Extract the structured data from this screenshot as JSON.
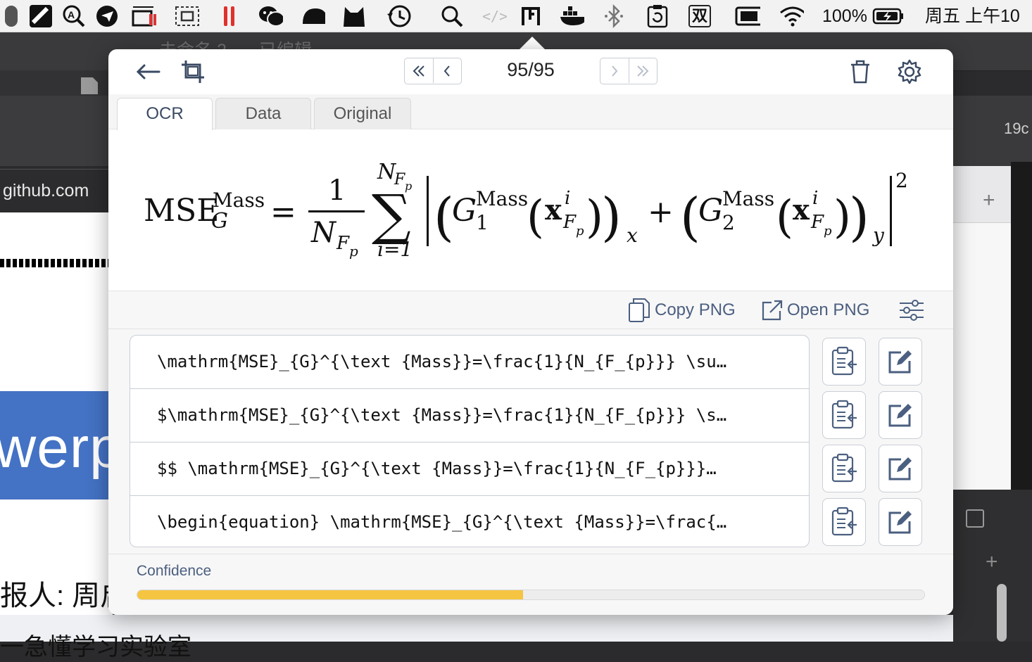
{
  "menubar": {
    "battery": "100%",
    "ime": "双",
    "datetime": "周五 上午10"
  },
  "background": {
    "browser_url": "github.com",
    "ghost_title_1": "未命名 2",
    "ghost_title_2": "已编辑",
    "slide_text": "werp",
    "reporter_text": "报人: 周启",
    "lab_text": "一急懂学习实验室",
    "right_text": "19c"
  },
  "popup": {
    "page_counter": "95/95",
    "tabs": [
      {
        "label": "OCR",
        "active": true
      },
      {
        "label": "Data",
        "active": false
      },
      {
        "label": "Original",
        "active": false
      }
    ],
    "actions": {
      "copy_png": "Copy PNG",
      "open_png": "Open PNG"
    },
    "results": [
      "\\mathrm{MSE}_{G}^{\\text {Mass}}=\\frac{1}{N_{F_{p}}} \\su…",
      "$\\mathrm{MSE}_{G}^{\\text {Mass}}=\\frac{1}{N_{F_{p}}} \\s…",
      "$$ \\mathrm{MSE}_{G}^{\\text {Mass}}=\\frac{1}{N_{F_{p}}}…",
      "\\begin{equation} \\mathrm{MSE}_{G}^{\\text {Mass}}=\\frac{…"
    ],
    "confidence": {
      "label": "Confidence",
      "value": 0.49,
      "bar_color": "#f5c542"
    },
    "formula": {
      "mse": "MSE",
      "mass": "Mass",
      "g": "G",
      "one": "1",
      "nf": "N",
      "f": "F",
      "p": "p",
      "i1": "i=1",
      "plus": "+",
      "eq": "=",
      "x": "x",
      "i": "i",
      "sub1": "1",
      "sub2": "2",
      "sx": "x",
      "sy": "y",
      "pow2": "2"
    }
  }
}
